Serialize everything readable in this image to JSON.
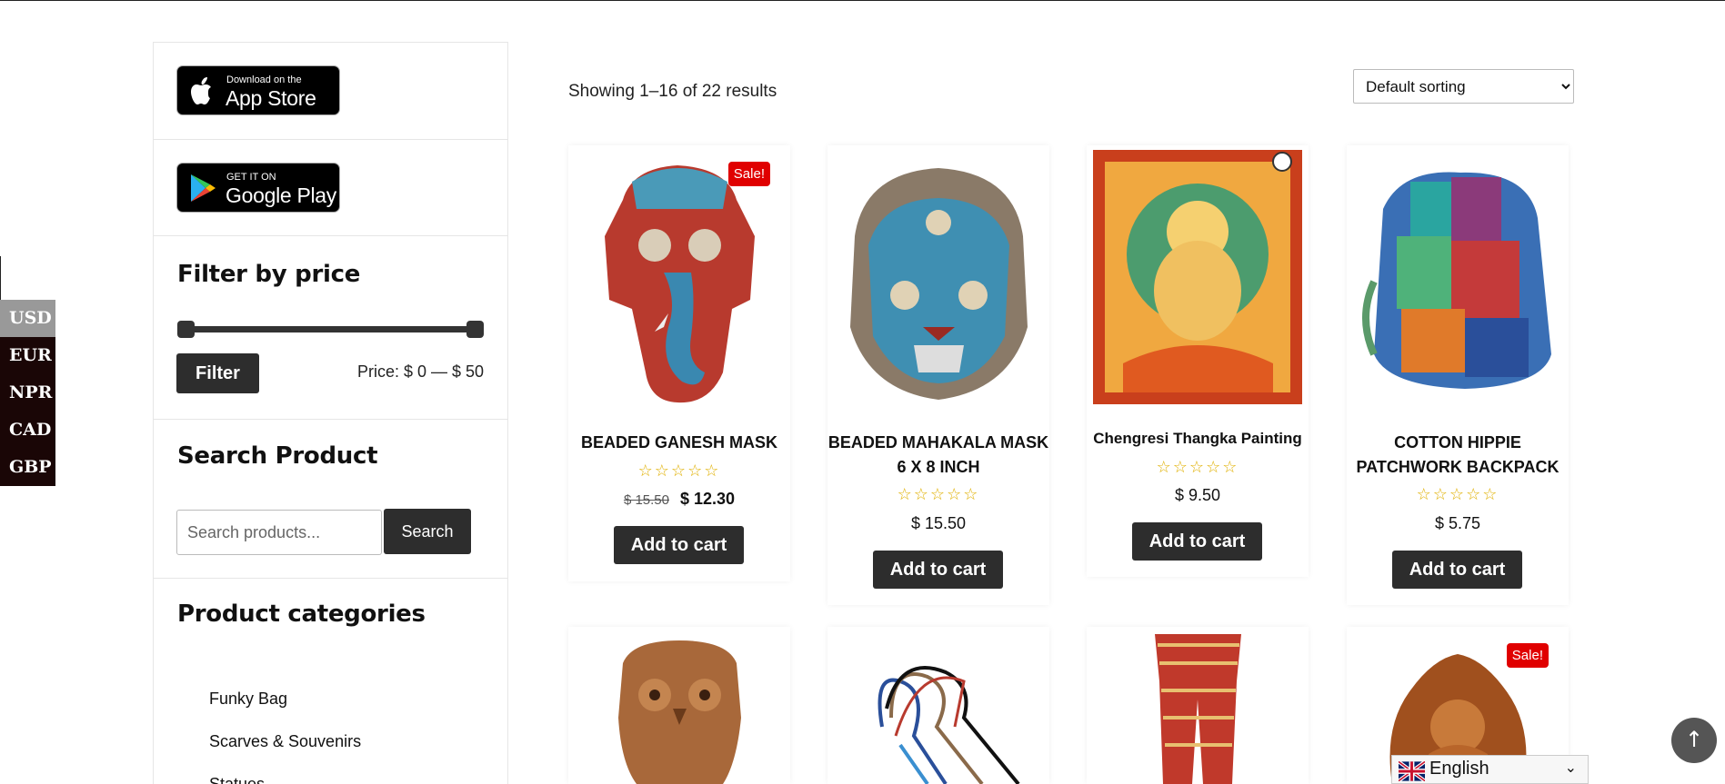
{
  "currency": {
    "options": [
      "USD",
      "EUR",
      "NPR",
      "CAD",
      "GBP"
    ],
    "selected": "USD"
  },
  "sidebar": {
    "app_store": {
      "small": "Download on the",
      "big": "App Store"
    },
    "google_play": {
      "small": "GET IT ON",
      "big": "Google Play"
    },
    "filter": {
      "title": "Filter by price",
      "button": "Filter",
      "price_label": "Price: $ 0 — $ 50",
      "range_min": 0,
      "range_max": 50
    },
    "search": {
      "title": "Search Product",
      "placeholder": "Search products...",
      "button": "Search"
    },
    "categories": {
      "title": "Product categories",
      "items": [
        "Funky Bag",
        "Scarves & Souvenirs",
        "Statues"
      ]
    }
  },
  "main": {
    "results_count": "Showing 1–16 of 22 results",
    "sorting": {
      "selected": "Default sorting"
    },
    "products": [
      {
        "name": "BEADED GANESH MASK",
        "sale": "Sale!",
        "old_price": "$ 15.50",
        "price": "$ 12.30",
        "stars": "☆☆☆☆☆",
        "button": "Add to cart"
      },
      {
        "name_line1": "BEADED MAHAKALA MASK",
        "name_line2": "6 X 8 INCH",
        "price": "$ 15.50",
        "stars": "☆☆☆☆☆",
        "button": "Add to cart"
      },
      {
        "name": "Chengresi Thangka Painting",
        "price": "$ 9.50",
        "stars": "☆☆☆☆☆",
        "button": "Add to cart"
      },
      {
        "name_line1": "COTTON HIPPIE",
        "name_line2": "PATCHWORK BACKPACK",
        "price": "$ 5.75",
        "stars": "☆☆☆☆☆",
        "button": "Add to cart"
      },
      {
        "sale": "Sale!"
      }
    ]
  },
  "language": {
    "label": "English"
  },
  "scroll_top": {
    "icon": "↑"
  }
}
